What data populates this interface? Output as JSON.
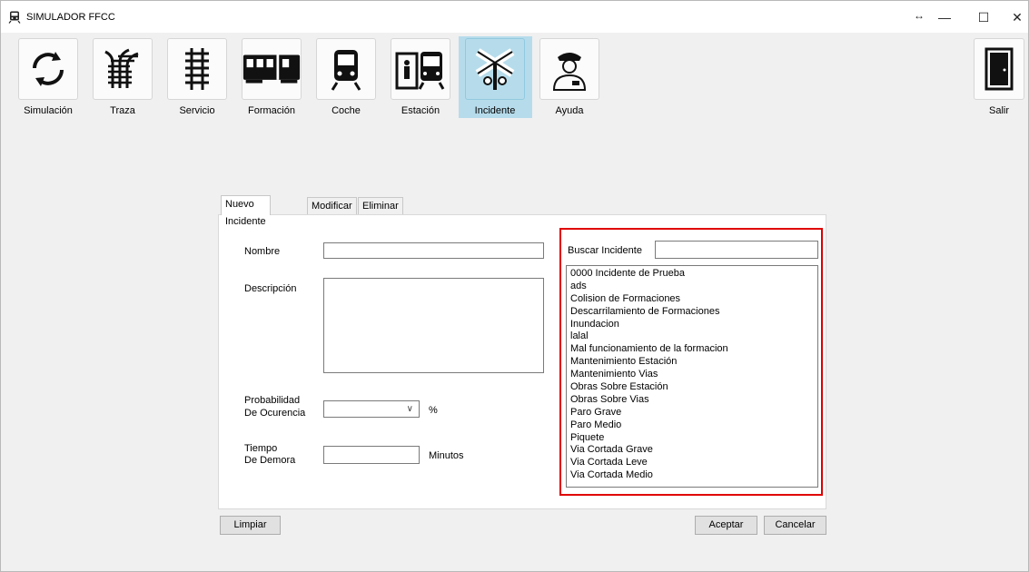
{
  "window": {
    "title": "SIMULADOR FFCC",
    "title_icon": "train-icon",
    "controls": {
      "arrows": "↔",
      "minimize": "—",
      "maximize": "☐",
      "close": "✕"
    }
  },
  "toolbar": {
    "items": [
      {
        "label": "Simulación",
        "icon": "refresh-icon"
      },
      {
        "label": "Traza",
        "icon": "track-switch-icon"
      },
      {
        "label": "Servicio",
        "icon": "rail-track-icon"
      },
      {
        "label": "Formación",
        "icon": "train-formation-icon"
      },
      {
        "label": "Coche",
        "icon": "train-car-icon"
      },
      {
        "label": "Estación",
        "icon": "station-icon"
      },
      {
        "label": "Incidente",
        "icon": "railway-crossing-icon",
        "active": true
      },
      {
        "label": "Ayuda",
        "icon": "conductor-icon"
      }
    ],
    "exit": {
      "label": "Salir",
      "icon": "door-icon"
    }
  },
  "tabs": [
    "Nuevo Incidente",
    "Modificar",
    "Eliminar"
  ],
  "form": {
    "nombre_label": "Nombre",
    "nombre_value": "",
    "descripcion_label": "Descripción",
    "descripcion_value": "",
    "probabilidad_label_1": "Probabilidad",
    "probabilidad_label_2": "De Ocurencia",
    "probabilidad_value": "",
    "probabilidad_unit": "%",
    "tiempo_label_1": "Tiempo",
    "tiempo_label_2": "De Demora",
    "tiempo_value": "",
    "tiempo_unit": "Minutos"
  },
  "search": {
    "label": "Buscar Incidente",
    "value": ""
  },
  "incidents": [
    "0000 Incidente de Prueba",
    "ads",
    "Colision de Formaciones",
    "Descarrilamiento de Formaciones",
    "Inundacion",
    "lalal",
    "Mal funcionamiento de la formacion",
    "Mantenimiento Estación",
    "Mantenimiento Vias",
    "Obras Sobre Estación",
    "Obras Sobre Vias",
    "Paro Grave",
    "Paro Medio",
    "Piquete",
    "Via Cortada Grave",
    "Via Cortada Leve",
    "Via Cortada Medio"
  ],
  "buttons": {
    "limpiar": "Limpiar",
    "aceptar": "Aceptar",
    "cancelar": "Cancelar"
  },
  "colors": {
    "active_tab": "#b6dceb",
    "highlight": "#e00000"
  }
}
